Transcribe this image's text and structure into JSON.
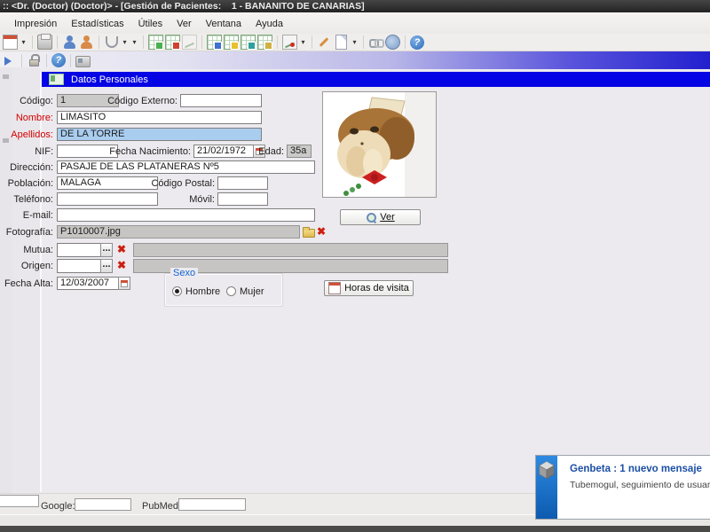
{
  "window": {
    "title": ":: <Dr. (Doctor) (Doctor)> - [Gestión de Pacientes:    1 - BANANITO DE CANARIAS]"
  },
  "menu": {
    "items": [
      "Impresión",
      "Estadísticas",
      "Útiles",
      "Ver",
      "Ventana",
      "Ayuda"
    ]
  },
  "toolbar_main": {
    "icons": [
      "calendar-dropdown",
      "printer",
      "patient-verified",
      "patient-add",
      "stethoscope-dropdown",
      "visits-table-green",
      "visits-table-red",
      "chart-disabled",
      "grid-blue",
      "grid-star",
      "grid-teal",
      "grid-yellow",
      "chart-annotate-dropdown",
      "pencil",
      "new-document-dropdown",
      "link",
      "web",
      "help"
    ]
  },
  "toolbar_secondary": {
    "icons": [
      "forward-arrow",
      "lock",
      "info",
      "id-card"
    ]
  },
  "section": {
    "title": "Datos Personales"
  },
  "form": {
    "codigo": {
      "label": "Código:",
      "value": "1"
    },
    "codigo_externo": {
      "label": "Código Externo:",
      "value": ""
    },
    "nombre": {
      "label": "Nombre:",
      "value": "LIMASITO"
    },
    "apellidos": {
      "label": "Apellidos:",
      "value": "DE LA TORRE"
    },
    "nif": {
      "label": "NIF:",
      "value": ""
    },
    "fecha_nacimiento": {
      "label": "Fecha Nacimiento:",
      "value": "21/02/1972"
    },
    "edad": {
      "label": "Edad:",
      "value": "35a"
    },
    "direccion": {
      "label": "Dirección:",
      "value": "PASAJE DE LAS PLATANERAS Nº5"
    },
    "poblacion": {
      "label": "Población:",
      "value": "MALAGA"
    },
    "codigo_postal": {
      "label": "Código Postal:",
      "value": ""
    },
    "telefono": {
      "label": "Teléfono:",
      "value": ""
    },
    "movil": {
      "label": "Móvil:",
      "value": ""
    },
    "email": {
      "label": "E-mail:",
      "value": ""
    },
    "fotografia": {
      "label": "Fotografía:",
      "value": "P1010007.jpg"
    },
    "mutua": {
      "label": "Mutua:",
      "value": ""
    },
    "origen": {
      "label": "Origen:",
      "value": ""
    },
    "fecha_alta": {
      "label": "Fecha Alta:",
      "value": "12/03/2007"
    }
  },
  "photo": {
    "ver_label": "Ver"
  },
  "sexo": {
    "label": "Sexo",
    "options": [
      "Hombre",
      "Mujer"
    ],
    "selected": "Hombre"
  },
  "buttons": {
    "horas_visita": "Horas de visita"
  },
  "footer": {
    "google_label": "Google:",
    "pubmed_label": "PubMed:"
  },
  "notification": {
    "title": "Genbeta : 1 nuevo mensaje",
    "body": "Tubemogul, seguimiento de usuarios y víd"
  },
  "colors": {
    "section_header": "#0404E4",
    "selection_field": "#A9CDEF",
    "required_label": "#D40000",
    "sexo_label": "#1464D2",
    "notification_title": "#1B4FA5",
    "notification_side": "#1479D0"
  }
}
